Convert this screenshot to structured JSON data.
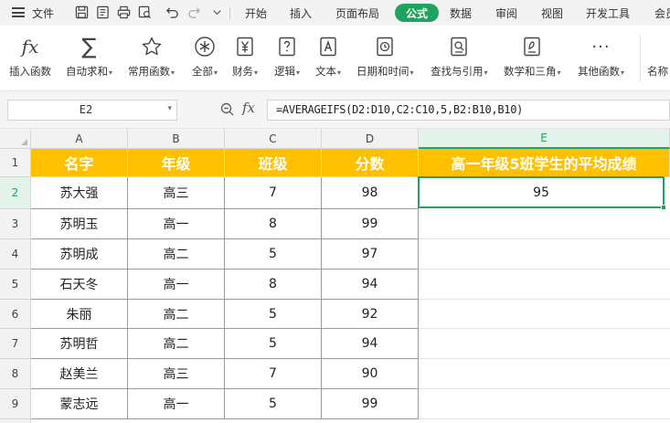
{
  "menubar": {
    "file_label": "文件",
    "tabs": [
      "开始",
      "插入",
      "页面布局",
      "公式",
      "数据",
      "审阅",
      "视图",
      "开发工具",
      "会员"
    ],
    "active_tab": "公式"
  },
  "ribbon": {
    "items": [
      {
        "label": "插入函数",
        "icon": "fx-icon",
        "dropdown": false
      },
      {
        "label": "自动求和",
        "icon": "sigma-icon",
        "dropdown": true
      },
      {
        "label": "常用函数",
        "icon": "star-icon",
        "dropdown": true
      },
      {
        "label": "全部",
        "icon": "asterisk-icon",
        "dropdown": true
      },
      {
        "label": "财务",
        "icon": "yen-icon",
        "dropdown": true
      },
      {
        "label": "逻辑",
        "icon": "question-icon",
        "dropdown": true
      },
      {
        "label": "文本",
        "icon": "text-a-icon",
        "dropdown": true
      },
      {
        "label": "日期和时间",
        "icon": "clock-icon",
        "dropdown": true
      },
      {
        "label": "查找与引用",
        "icon": "search-doc-icon",
        "dropdown": true
      },
      {
        "label": "数学和三角",
        "icon": "theta-icon",
        "dropdown": true
      },
      {
        "label": "其他函数",
        "icon": "more-icon",
        "dropdown": true
      },
      {
        "label": "名称",
        "icon": "name-icon",
        "dropdown": false
      }
    ]
  },
  "formula_bar": {
    "name_box": "E2",
    "formula": "=AVERAGEIFS(D2:D10,C2:C10,5,B2:B10,B10)"
  },
  "sheet": {
    "columns": [
      "A",
      "B",
      "C",
      "D",
      "E"
    ],
    "selected_column": "E",
    "selected_row": "2",
    "row_numbers": [
      "1",
      "2",
      "3",
      "4",
      "5",
      "6",
      "7",
      "8",
      "9"
    ],
    "header": [
      "名字",
      "年级",
      "班级",
      "分数",
      "高一年级5班学生的平均成绩"
    ],
    "rows": [
      [
        "苏大强",
        "高三",
        "7",
        "98",
        "95"
      ],
      [
        "苏明玉",
        "高一",
        "8",
        "99",
        ""
      ],
      [
        "苏明成",
        "高二",
        "5",
        "97",
        ""
      ],
      [
        "石天冬",
        "高一",
        "8",
        "94",
        ""
      ],
      [
        "朱丽",
        "高二",
        "5",
        "92",
        ""
      ],
      [
        "苏明哲",
        "高二",
        "5",
        "94",
        ""
      ],
      [
        "赵美兰",
        "高三",
        "7",
        "90",
        ""
      ],
      [
        "蒙志远",
        "高一",
        "5",
        "99",
        ""
      ]
    ],
    "colors": {
      "header_fill": "#ffc000",
      "header_text": "#ffffff",
      "accent": "#1fa35f"
    }
  }
}
